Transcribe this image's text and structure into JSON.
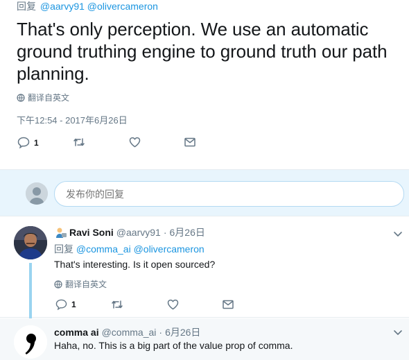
{
  "main_tweet": {
    "reply_prefix": "回复",
    "reply_handles": "@aarvy91 @olivercameron",
    "text": "That's only perception. We use an automatic ground truthing engine to ground truth our path planning.",
    "translate_label": "翻译自英文",
    "timestamp": "下午12:54 - 2017年6月26日",
    "actions": {
      "reply_count": "1",
      "retweet_count": "",
      "like_count": "",
      "icons": [
        "reply-icon",
        "retweet-icon",
        "like-icon",
        "message-icon"
      ]
    }
  },
  "compose": {
    "placeholder": "发布你的回复"
  },
  "replies": {
    "ravi": {
      "name": "Ravi Soni",
      "handle": "@aarvy91",
      "separator": "·",
      "date": "6月26日",
      "reply_prefix": "回复",
      "reply_handles": "@comma_ai @olivercameron",
      "text": "That's interesting. Is it open sourced?",
      "translate_label": "翻译自英文",
      "reply_count": "1"
    },
    "comma": {
      "name": "comma ai",
      "handle": "@comma_ai",
      "separator": "·",
      "date": "6月26日",
      "text": "Haha, no. This is a big part of the value prop of comma."
    }
  },
  "colors": {
    "link": "#1b95e0",
    "muted": "#657786",
    "compose_bg": "#e8f5fd",
    "thread_line": "#9ad4f0"
  }
}
